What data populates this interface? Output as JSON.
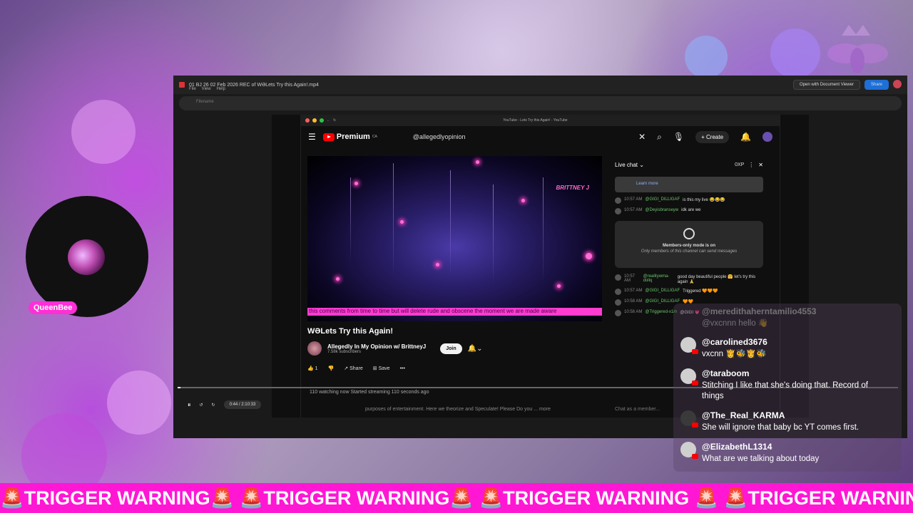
{
  "viewer": {
    "file_title": "01 BJ 26 02 Feb 2026 REC of WƏLets Try this Again!.mp4",
    "menu": [
      "File",
      "View",
      "Help"
    ],
    "open_with_label": "Open with Document Viewer",
    "share_label": "Share",
    "address_text": "Filename"
  },
  "browser": {
    "tab_title": "YouTube - Lets Try this Again! - YouTube"
  },
  "youtube": {
    "logo_text": "Premium",
    "logo_superscript": "CA",
    "search_query": "@allegedlyopinion",
    "create_label": "Create",
    "video_watermark": "BRITTNEY J",
    "video_ticker": "this comments from time to time but will delete rude and obscene the moment we are made aware",
    "video_title": "WƏLets Try this Again!",
    "channel_name": "Allegedly In My Opinion w/ BrittneyJ",
    "channel_subs": "7.58k subscribers",
    "join_label": "Join",
    "like_count": "1",
    "share_label": "Share",
    "save_label": "Save",
    "live_info": "110 watching now  Started streaming 110 seconds ago",
    "description": "purposes of entertainment. Here we theorize and Speculate! Please Do you ... more",
    "time_display": "0:44 / 2:10:33",
    "chat_box_placeholder": "Chat as a member..."
  },
  "live_chat": {
    "header": "Live chat",
    "xp": "0XP",
    "learn_more": "Learn more",
    "messages": [
      {
        "time": "10:57 AM",
        "user": "@GIGI_DILLIGAF",
        "text": "is this my live 😂😂😂"
      },
      {
        "time": "10:57 AM",
        "user": "@Deyisbranseyw",
        "text": "idk are we"
      },
      {
        "time": "10:57 AM",
        "user": "@realitywma-dollq",
        "text": "good day beautiful people 🤗 let's try this again 🙏"
      },
      {
        "time": "10:57 AM",
        "user": "@GIGI_DILLIGAF",
        "text": "Triggered 🧡🧡🧡"
      },
      {
        "time": "10:58 AM",
        "user": "@GIGI_DILLIGAF",
        "text": "🧡🧡"
      },
      {
        "time": "10:58 AM",
        "user": "@Triggered-x1m",
        "text": "@GIGI 💗"
      }
    ],
    "members_title": "Members-only mode is on",
    "members_sub": "Only members of this channel can send messages"
  },
  "streamer": {
    "label": "QueenBee"
  },
  "overlay_chat": [
    {
      "user": "@meredithahern​tamilio4553",
      "text": "@vxcnnn hello 👋",
      "faded": true
    },
    {
      "user": "@carolined3676",
      "text": "vxcnn 👸🐝👸🐝",
      "faded": false
    },
    {
      "user": "@taraboom",
      "text": "Stitching I like that she's doing that. Record of things",
      "faded": false
    },
    {
      "user": "@The_Real_KARMA",
      "text": "She will ignore that baby bc YT comes first.",
      "faded": false
    },
    {
      "user": "@ElizabethL1314",
      "text": "What are we talking about today",
      "faded": false
    }
  ],
  "ticker_text": "🚨TRIGGER WARNING🚨 🚨TRIGGER WARNING🚨 🚨TRIGGER WARNING 🚨 🚨TRIGGER WARNING 🚨 🚨TRIGGER WARNING 🚨 🚨T",
  "colors": {
    "ticker_bg": "#ff17d4",
    "label_bg": "#ff2fd6",
    "yt_red": "#ff0000"
  }
}
